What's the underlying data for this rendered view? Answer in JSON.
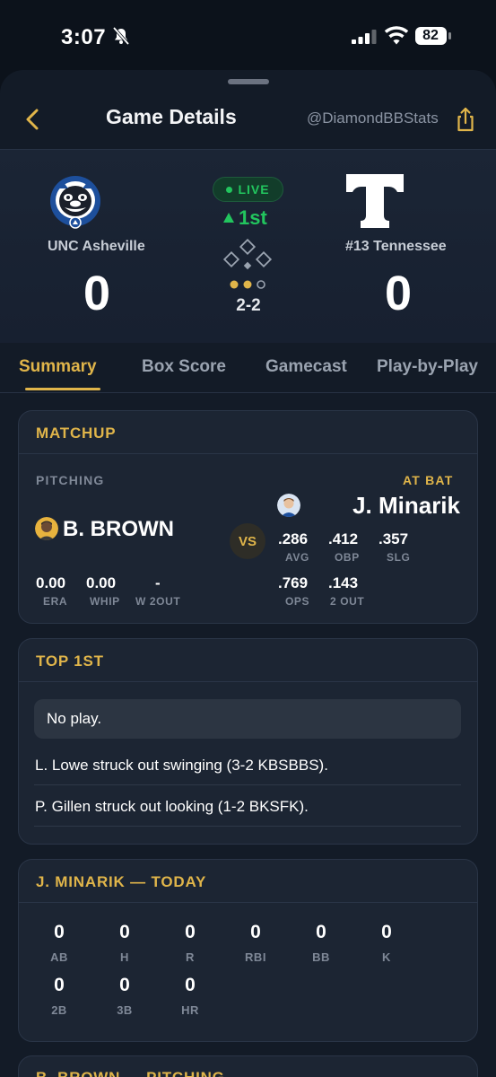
{
  "status_bar": {
    "time": "3:07",
    "battery": "82"
  },
  "nav": {
    "title": "Game Details",
    "handle": "@DiamondBBStats"
  },
  "game": {
    "status": "LIVE",
    "inning": "1st",
    "count": "2-2",
    "home": {
      "name": "UNC Asheville",
      "score": "0"
    },
    "away": {
      "name": "#13 Tennessee",
      "score": "0"
    }
  },
  "tabs": [
    "Summary",
    "Box Score",
    "Gamecast",
    "Play-by-Play"
  ],
  "matchup": {
    "title": "MATCHUP",
    "pitching_label": "PITCHING",
    "at_bat_label": "AT BAT",
    "vs": "VS",
    "pitcher": {
      "name": "B. BROWN",
      "stats": [
        {
          "value": "0.00",
          "label": "ERA"
        },
        {
          "value": "0.00",
          "label": "WHIP"
        },
        {
          "value": "-",
          "label": "W 2OUT"
        }
      ]
    },
    "batter": {
      "name": "J. Minarik",
      "stats_row1": [
        {
          "value": ".286",
          "label": "AVG"
        },
        {
          "value": ".412",
          "label": "OBP"
        },
        {
          "value": ".357",
          "label": "SLG"
        }
      ],
      "stats_row2": [
        {
          "value": ".769",
          "label": "OPS"
        },
        {
          "value": ".143",
          "label": "2 OUT"
        }
      ]
    }
  },
  "top_first": {
    "title": "TOP 1ST",
    "plays": [
      "No play.",
      "L. Lowe struck out swinging (3-2 KBSBBS).",
      "P. Gillen struck out looking (1-2 BKSFK)."
    ]
  },
  "today": {
    "title": "J. MINARIK — TODAY",
    "row1": [
      {
        "value": "0",
        "label": "AB"
      },
      {
        "value": "0",
        "label": "H"
      },
      {
        "value": "0",
        "label": "R"
      },
      {
        "value": "0",
        "label": "RBI"
      },
      {
        "value": "0",
        "label": "BB"
      },
      {
        "value": "0",
        "label": "K"
      }
    ],
    "row2": [
      {
        "value": "0",
        "label": "2B"
      },
      {
        "value": "0",
        "label": "3B"
      },
      {
        "value": "0",
        "label": "HR"
      }
    ]
  },
  "next_card": {
    "title": "B. BROWN — PITCHING"
  },
  "colors": {
    "accent": "#e0b54a",
    "live": "#22c55e",
    "background": "#0c121b",
    "card": "#1c2533"
  }
}
